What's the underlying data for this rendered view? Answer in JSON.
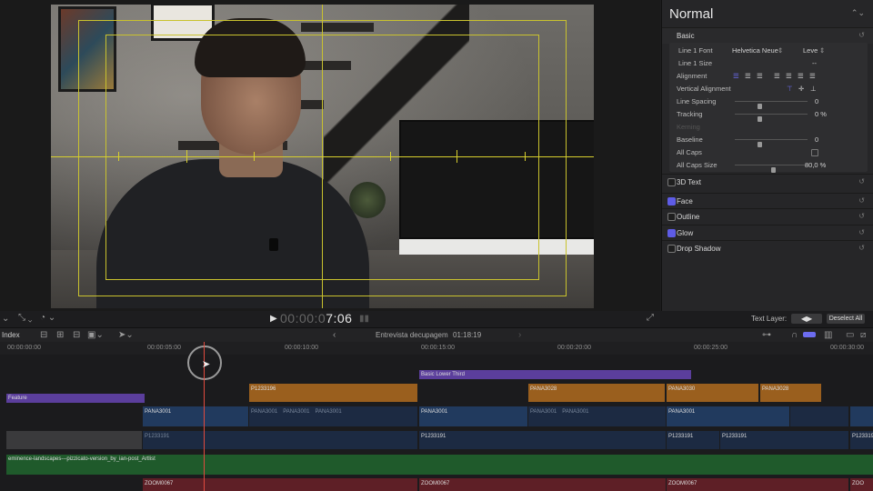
{
  "viewer": {
    "timecode_dim": "00:00:0",
    "timecode": "7:06"
  },
  "inspector": {
    "title": "Normal",
    "basic_label": "Basic",
    "line1_font_label": "Line 1 Font",
    "line1_font_value": "Helvetica Neue",
    "line1_weight_value": "Leve",
    "line1_size_label": "Line 1 Size",
    "line1_size_value": "--",
    "alignment_label": "Alignment",
    "vertical_alignment_label": "Vertical Alignment",
    "line_spacing_label": "Line Spacing",
    "line_spacing_value": "0",
    "tracking_label": "Tracking",
    "tracking_value": "0 %",
    "kerning_label": "Kerning",
    "baseline_label": "Baseline",
    "baseline_value": "0",
    "all_caps_label": "All Caps",
    "all_caps_size_label": "All Caps Size",
    "all_caps_size_value": "80,0 %",
    "sections": [
      {
        "label": "3D Text",
        "checked": false
      },
      {
        "label": "Face",
        "checked": true
      },
      {
        "label": "Outline",
        "checked": false
      },
      {
        "label": "Glow",
        "checked": true
      },
      {
        "label": "Drop Shadow",
        "checked": false
      }
    ],
    "text_layer_label": "Text Layer:",
    "deselect_all_label": "Deselect All"
  },
  "timeline": {
    "index_label": "Index",
    "project_name": "Entrevista decupagem",
    "duration": "01:18:19",
    "ruler": [
      "00:00:00:00",
      "00:00:05:00",
      "00:00:10:00",
      "00:00:15:00",
      "00:00:20:00",
      "00:00:25:00",
      "00:00:30:00"
    ],
    "clips": {
      "lower_third": "Basic Lower Third",
      "feature": "Feature",
      "p1233196": "P1233196",
      "pana3028a": "PANA3028",
      "pana3030": "PANA3030",
      "pana3028b": "PANA3028",
      "pana3001a": "PANA3001",
      "pana3001b": "PANA3001",
      "pana3001c": "PANA3001",
      "pana3001d": "PANA3001",
      "pana3001e": "PANA3001",
      "pana3001f": "PANA3001",
      "pana3001g": "PANA3001",
      "pana3001h": "PANA3001",
      "p1233191a": "P1233191",
      "p1233191b": "P1233191",
      "p1233191c": "P1233191",
      "p1233191d": "P1233191",
      "p1233191e": "P1233191",
      "audio": "eminence-landscapes---pizzicato-version_by_ian-post_Artlist",
      "zoom1": "ZOOM0067",
      "zoom2": "ZOOM0067",
      "zoom3": "ZOOM0067",
      "zoom4": "ZOO"
    }
  },
  "colors": {
    "accent": "#5e5ce6",
    "playhead": "#e14b3f",
    "title_guides": "#d7cf2e"
  }
}
